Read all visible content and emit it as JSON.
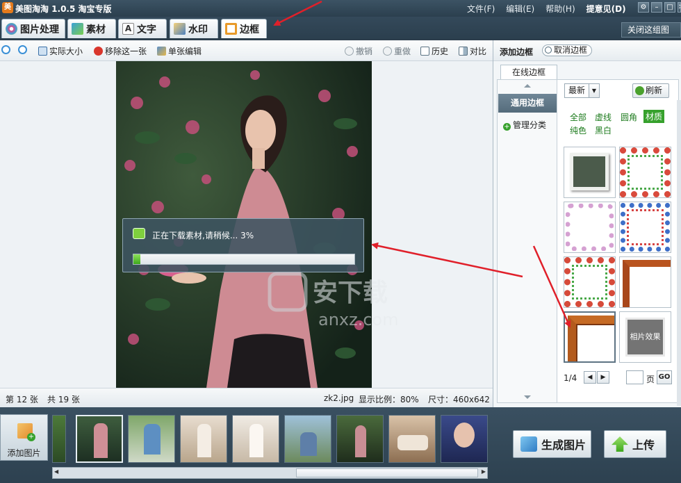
{
  "window": {
    "title": "美图淘淘 1.0.5 淘宝专版",
    "menus": [
      "文件(F)",
      "编辑(E)",
      "帮助(H)",
      "提意见(D)"
    ],
    "controls": {
      "settings": "⚙",
      "minimize": "–",
      "maximize": "□",
      "close": "✕"
    }
  },
  "tabs": [
    {
      "label": "图片处理",
      "icon": "image-processing-icon",
      "color": "#d94a8c"
    },
    {
      "label": "素材",
      "icon": "material-icon",
      "color": "#3aa0d8"
    },
    {
      "label": "文字",
      "icon": "text-icon",
      "color": "#e8b040"
    },
    {
      "label": "水印",
      "icon": "watermark-icon",
      "color": "#4a7fbf"
    },
    {
      "label": "边框",
      "icon": "border-icon",
      "color": "#e89a2a"
    }
  ],
  "close_group": "关闭这组图",
  "toolbar": {
    "actual_size": "实际大小",
    "remove_one": "移除这一张",
    "single_edit": "单张编辑",
    "undo": "撤销",
    "redo": "重做",
    "history": "历史",
    "compare": "对比"
  },
  "download": {
    "text": "正在下载素材,请稍候... 3%",
    "progress": 0.03
  },
  "status": {
    "current": "第 12 张",
    "total": "共 19 张",
    "filename": "zk2.jpg",
    "scale": "显示比例：80%",
    "size": "尺寸：460x642"
  },
  "border_panel": {
    "title": "添加边框",
    "cancel": "取消边框",
    "online_tab": "在线边框",
    "category_selected": "通用边框",
    "manage": "管理分类",
    "sort": "最新",
    "refresh": "刷新",
    "filters": [
      "全部",
      "虚线",
      "圆角",
      "材质",
      "纯色",
      "黑白"
    ],
    "selected_filter": "材质",
    "thumb_label": "相片效果",
    "page_indicator": "1/4",
    "page_input": "",
    "page_label": "页",
    "go": "GO"
  },
  "bottom": {
    "add_image": "添加图片",
    "generate": "生成图片",
    "upload": "上传"
  },
  "watermark": {
    "main": "安下载",
    "sub": "anxz.com"
  }
}
